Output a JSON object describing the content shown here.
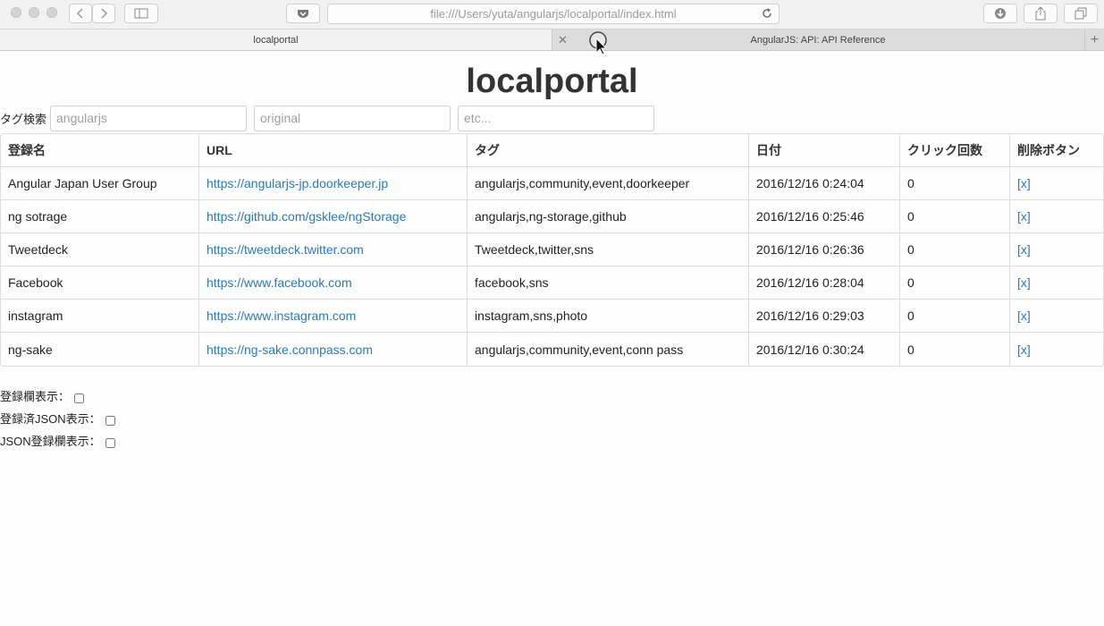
{
  "browser": {
    "url": "file:///Users/yuta/angularjs/localportal/index.html",
    "tabs": [
      {
        "label": "localportal",
        "active": true
      },
      {
        "label": "AngularJS: API: API Reference",
        "active": false
      }
    ]
  },
  "page": {
    "title": "localportal",
    "search": {
      "label": "タグ検索",
      "placeholders": [
        "angularjs",
        "original",
        "etc..."
      ]
    },
    "table": {
      "headers": [
        "登録名",
        "URL",
        "タグ",
        "日付",
        "クリック回数",
        "削除ボタン"
      ],
      "rows": [
        {
          "name": "Angular Japan User Group",
          "url": "https://angularjs-jp.doorkeeper.jp",
          "tags": "angularjs,community,event,doorkeeper",
          "date": "2016/12/16 0:24:04",
          "clicks": "0",
          "delete": "[x]"
        },
        {
          "name": "ng sotrage",
          "url": "https://github.com/gsklee/ngStorage",
          "tags": "angularjs,ng-storage,github",
          "date": "2016/12/16 0:25:46",
          "clicks": "0",
          "delete": "[x]"
        },
        {
          "name": "Tweetdeck",
          "url": "https://tweetdeck.twitter.com",
          "tags": "Tweetdeck,twitter,sns",
          "date": "2016/12/16 0:26:36",
          "clicks": "0",
          "delete": "[x]"
        },
        {
          "name": "Facebook",
          "url": "https://www.facebook.com",
          "tags": "facebook,sns",
          "date": "2016/12/16 0:28:04",
          "clicks": "0",
          "delete": "[x]"
        },
        {
          "name": "instagram",
          "url": "https://www.instagram.com",
          "tags": "instagram,sns,photo",
          "date": "2016/12/16 0:29:03",
          "clicks": "0",
          "delete": "[x]"
        },
        {
          "name": "ng-sake",
          "url": "https://ng-sake.connpass.com",
          "tags": "angularjs,community,event,conn pass",
          "date": "2016/12/16 0:30:24",
          "clicks": "0",
          "delete": "[x]"
        }
      ]
    },
    "options": [
      {
        "label": "登録欄表示：",
        "checked": false
      },
      {
        "label": "登録済JSON表示：",
        "checked": false
      },
      {
        "label": "JSON登録欄表示：",
        "checked": false
      }
    ]
  },
  "colors": {
    "link": "#2a7ab8",
    "title": "#333333"
  }
}
